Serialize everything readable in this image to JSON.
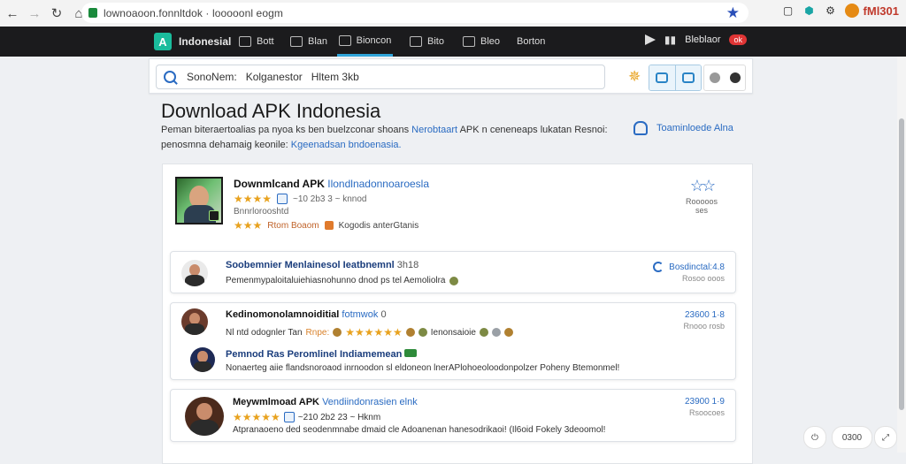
{
  "browser": {
    "url": "lownoaoon.fonnltdok · looooonl eogm",
    "profile_label": "fMl301"
  },
  "nav": {
    "brand": "Indonesial",
    "items": [
      "Bott",
      "Blan",
      "Bioncon",
      "Bito",
      "Bleo",
      "Borton"
    ],
    "active_index": 2,
    "right_label": "Bleblaor",
    "badge": "ok"
  },
  "search": {
    "value": "SonoNem:   Kolganestor   Hltem 3kb"
  },
  "heading": {
    "title": "Download APK Indonesia",
    "desc_line1": "Peman biteraertoalias pa nyoa ks ben buelzconar shoans",
    "desc_link1": "Nerobtaart",
    "desc_line1b": "APK n ceneneaps lukatan Resnoi:",
    "desc_line2": "penosmna dehamaig keonile:",
    "desc_link2": "Kgeenadsan bndoenasia.",
    "side_link": "Toaminloede Alna"
  },
  "featured": {
    "title": "Downmlcand APK",
    "title_link": "Ilondlnadonnoaroesla",
    "meta": "~10 2b3 3  ~ knnod",
    "developer": "Bnnrlorooshtd",
    "rating_text": "Rtom Boaom",
    "tag_text": "Kogodis anterGtanis",
    "fav_label": "Rooooos ses"
  },
  "list": [
    {
      "title": "Soobemnier",
      "title_rest": "Menlainesol Ieatbnemnl",
      "title_tail": "3h18",
      "sub": "Pemenmypaloitaluiehiasnohunno dnod ps tel Aemoliolra",
      "right_top": "Bosdinctal:4.8",
      "right_sub": "Rosoo ooos"
    },
    {
      "title": "Kedinomonolamnoiditial",
      "title_rest": "fotmwok",
      "title_tail": "0",
      "sub1": "Nl ntd odognler  Tan",
      "sub1_orange": "Rnpe:",
      "sub1_tail": "Ienonsaioie",
      "right_top": "23600 1·8",
      "right_sub": "Rnooo rosb",
      "inner_title": "Pemnod Ras Peromlinel",
      "inner_title_rest": "Indiamemean",
      "inner_sub": "Nonaerteg aiie flandsnoroaod inrnoodon sl eldoneon lnerAPlohoeoloodonpolzer Poheny Btemonmel!"
    },
    {
      "title": "Meywmlmoad APK",
      "title_rest": "Vendiindonrasien elnk",
      "meta": "~210 2b2 23  ~ Hknm",
      "sub": "Atpranaoeno ded seodenmnabe dmaid cle Adoanenan hanesodrikaoi!   (Il6oid Fokely 3deoomol!",
      "right_top": "23900 1·9",
      "right_sub": "Rsoocoes"
    }
  ],
  "floating": {
    "zoom_label": "0300"
  },
  "colors": {
    "accent": "#2a6bc2",
    "brand": "#1abc9c",
    "star": "#e8a21e",
    "nav_bg": "#1b1b1d"
  }
}
